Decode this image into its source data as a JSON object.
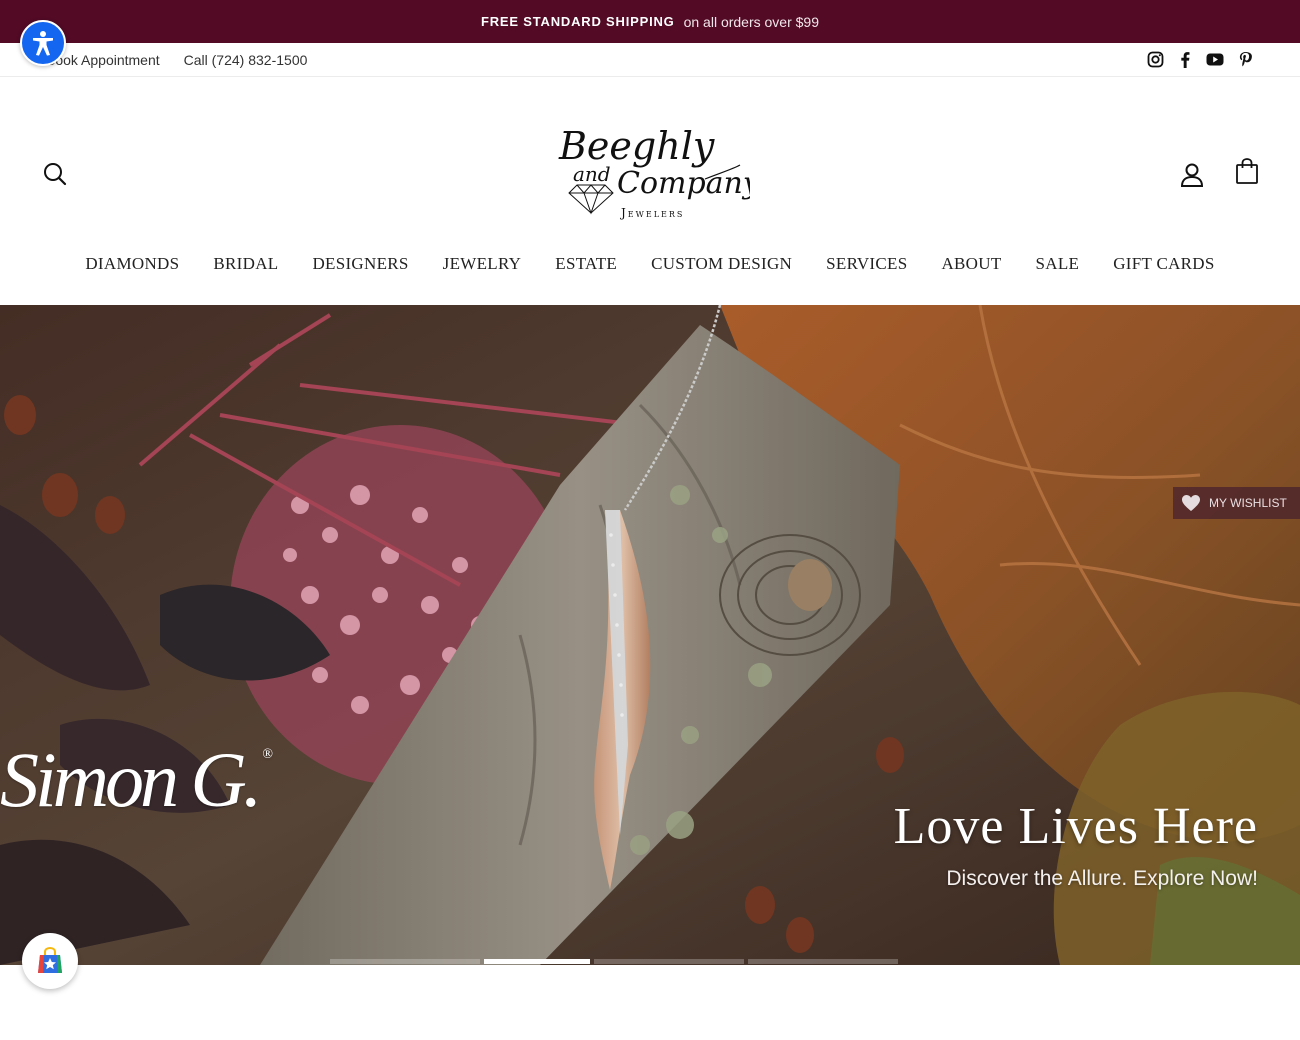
{
  "announcement": {
    "strong_text": "FREE STANDARD SHIPPING",
    "light_text": "on all orders over $99"
  },
  "utility": {
    "appointment": "Book Appointment",
    "phone": "Call (724) 832-1500",
    "social_icons": [
      "instagram-icon",
      "facebook-icon",
      "youtube-icon",
      "pinterest-icon"
    ]
  },
  "header": {
    "logo_line1": "Beeghly",
    "logo_and": "and",
    "logo_line2": "Company",
    "logo_line3": "Jewelers"
  },
  "nav": {
    "items": [
      "DIAMONDS",
      "BRIDAL",
      "DESIGNERS",
      "JEWELRY",
      "ESTATE",
      "CUSTOM DESIGN",
      "SERVICES",
      "ABOUT",
      "SALE",
      "GIFT CARDS"
    ]
  },
  "hero": {
    "brand": "Simon G.",
    "brand_reg": "®",
    "title": "Love Lives Here",
    "subtitle": "Discover the Allure. Explore Now!",
    "wishlist_label": "MY WISHLIST",
    "active_slide": 2,
    "slide_count": 4
  },
  "colors": {
    "announcement_bg": "#520a25",
    "accessibility_blue": "#1466f0"
  }
}
